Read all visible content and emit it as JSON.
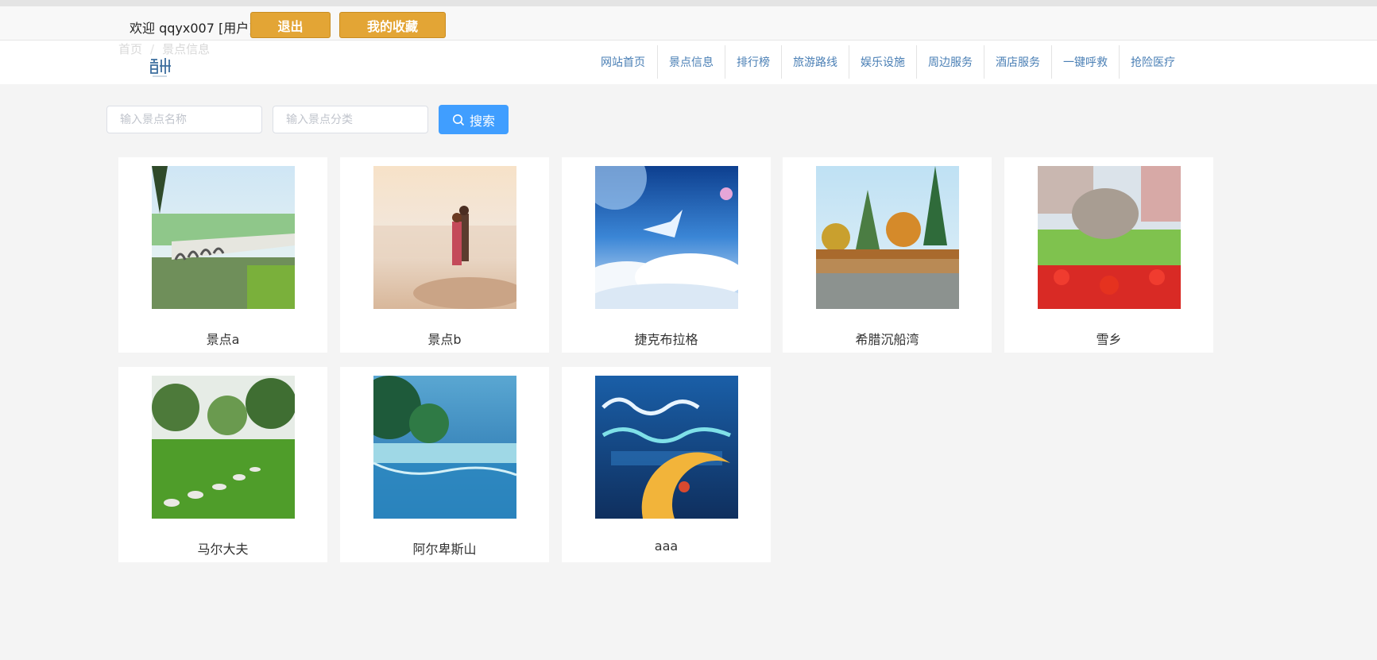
{
  "header": {
    "welcome": "欢迎 qqyx007 [用户]",
    "logout": "退出",
    "favorites": "我的收藏"
  },
  "breadcrumb": {
    "home": "首页",
    "sep": "/",
    "current": "景点信息"
  },
  "nav": {
    "items": [
      "网站首页",
      "景点信息",
      "排行榜",
      "旅游路线",
      "娱乐设施",
      "周边服务",
      "酒店服务",
      "一键呼救",
      "抢险医疗"
    ]
  },
  "search": {
    "name_placeholder": "输入景点名称",
    "category_placeholder": "输入景点分类",
    "button": "搜索"
  },
  "spots": [
    {
      "name": "景点a"
    },
    {
      "name": "景点b"
    },
    {
      "name": "捷克布拉格"
    },
    {
      "name": "希腊沉船湾"
    },
    {
      "name": "雪乡"
    },
    {
      "name": "马尔大夫"
    },
    {
      "name": "阿尔卑斯山"
    },
    {
      "name": "aaa"
    }
  ],
  "colors": {
    "accent_gold": "#e3a535",
    "primary_blue": "#409eff",
    "nav_text": "#4a7fb5"
  }
}
